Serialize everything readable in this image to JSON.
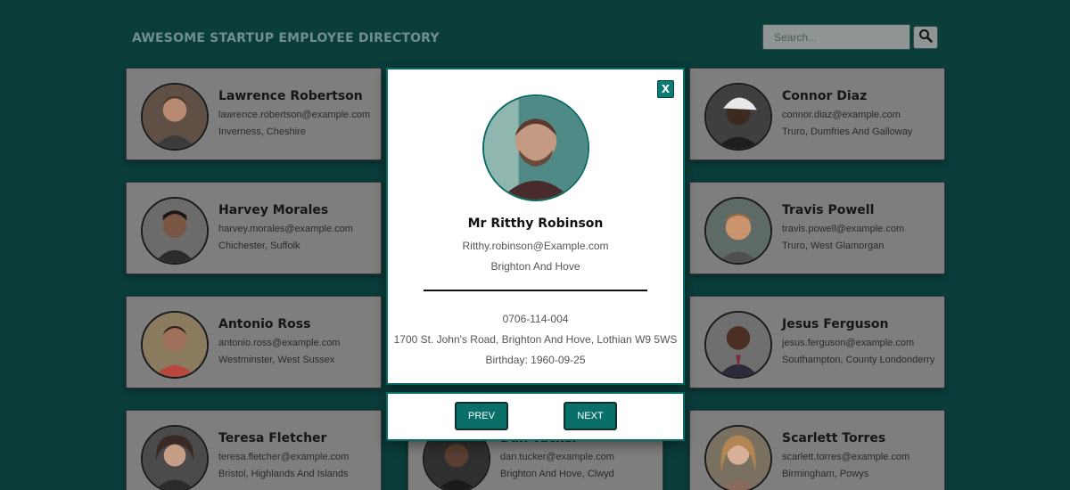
{
  "header": {
    "title": "AWESOME STARTUP EMPLOYEE DIRECTORY"
  },
  "search": {
    "placeholder": "Search...",
    "button_icon": "search-icon"
  },
  "employees": [
    {
      "name": "Lawrence Robertson",
      "email": "lawrence.robertson@example.com",
      "location": "Inverness, Cheshire"
    },
    {
      "name": "Connor Diaz",
      "email": "connor.diaz@example.com",
      "location": "Truro, Dumfries And Galloway"
    },
    {
      "name": "Harvey Morales",
      "email": "harvey.morales@example.com",
      "location": "Chichester, Suffolk"
    },
    {
      "name": "Travis Powell",
      "email": "travis.powell@example.com",
      "location": "Truro, West Glamorgan"
    },
    {
      "name": "Antonio Ross",
      "email": "antonio.ross@example.com",
      "location": "Westminster, West Sussex"
    },
    {
      "name": "Jesus Ferguson",
      "email": "jesus.ferguson@example.com",
      "location": "Southampton, County Londonderry"
    },
    {
      "name": "Teresa Fletcher",
      "email": "teresa.fletcher@example.com",
      "location": "Bristol, Highlands And Islands"
    },
    {
      "name": "Dan Tucker",
      "email": "dan.tucker@example.com",
      "location": "Brighton And Hove, Clwyd"
    },
    {
      "name": "Scarlett Torres",
      "email": "scarlett.torres@example.com",
      "location": "Birmingham, Powys"
    }
  ],
  "modal": {
    "close_label": "X",
    "name": "Mr Ritthy Robinson",
    "email": "Ritthy.robinson@Example.com",
    "city": "Brighton And Hove",
    "phone": "0706-114-004",
    "address": "1700 St. John's Road, Brighton And Hove, Lothian W9 5WS",
    "birthday": "Birthday: 1960-09-25"
  },
  "nav": {
    "prev_label": "PREV",
    "next_label": "NEXT"
  },
  "colors": {
    "background": "#0b3d3b",
    "accent": "#0b6f69",
    "card": "#7e7e7e"
  }
}
